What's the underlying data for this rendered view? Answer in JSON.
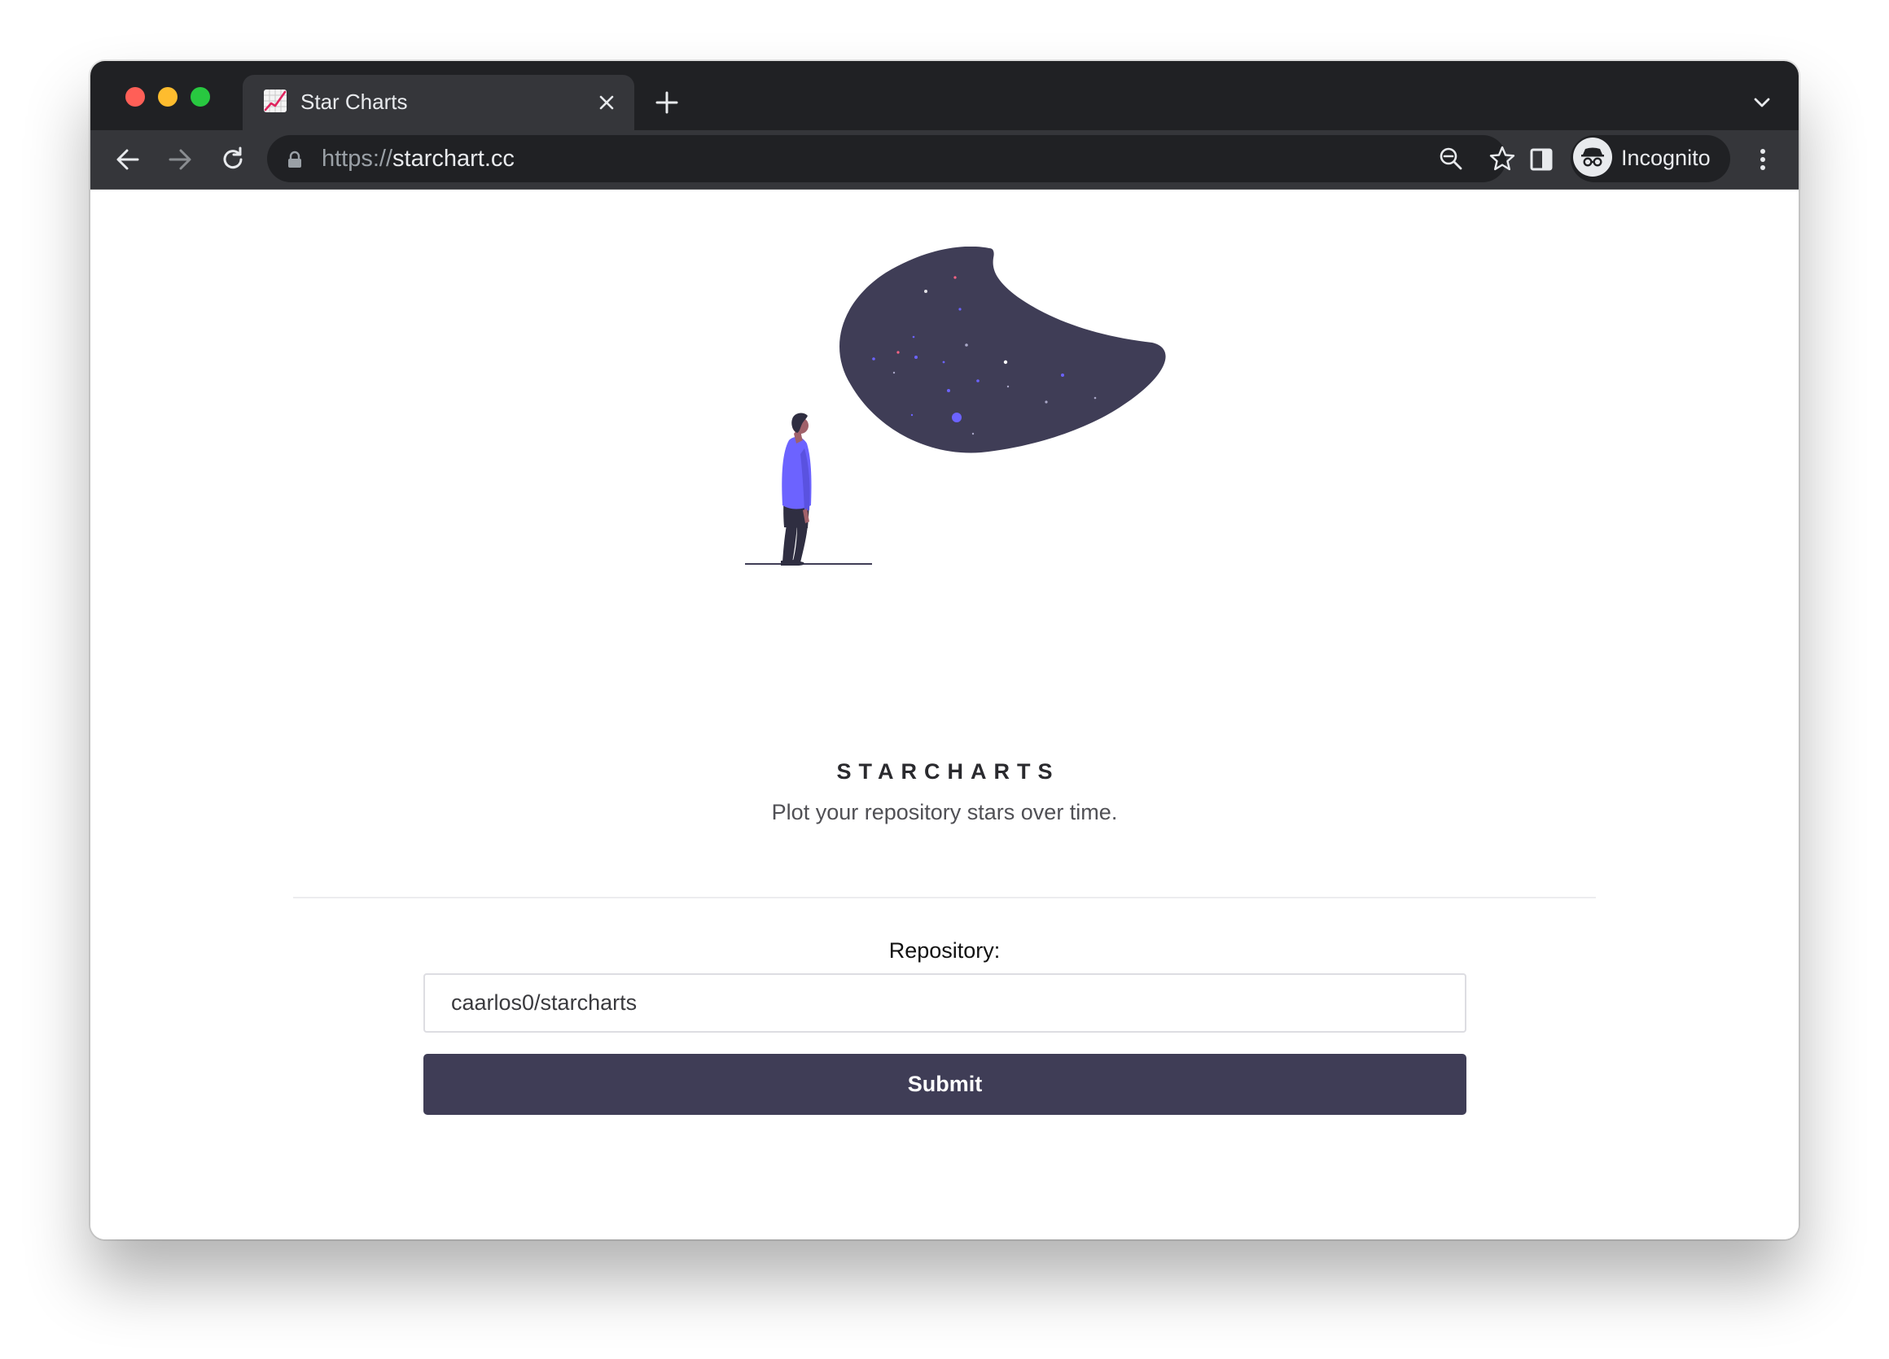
{
  "browser": {
    "tab": {
      "title": "Star Charts",
      "favicon": "chart-increasing-emoji-icon"
    },
    "address_bar": {
      "scheme": "https://",
      "host": "starchart.cc"
    },
    "profile": {
      "label": "Incognito",
      "icon": "incognito-icon"
    },
    "icons": {
      "back": "arrow-left-icon",
      "forward": "arrow-right-icon",
      "reload": "reload-icon",
      "zoom": "zoom-out-icon",
      "bookmark": "star-outline-icon",
      "side_panel": "side-panel-icon",
      "menu": "kebab-menu-icon",
      "new_tab": "plus-icon",
      "tab_search": "chevron-down-icon",
      "close_tab": "close-icon",
      "lock": "lock-icon"
    }
  },
  "page": {
    "brand": "STARCHARTS",
    "tagline": "Plot your repository stars over time.",
    "form": {
      "label": "Repository:",
      "input_value": "caarlos0/starcharts",
      "submit_label": "Submit"
    }
  },
  "colors": {
    "primary": "#3f3d56",
    "accent": "#6c63ff",
    "browser_dark": "#202124",
    "browser_toolbar": "#35363a"
  }
}
